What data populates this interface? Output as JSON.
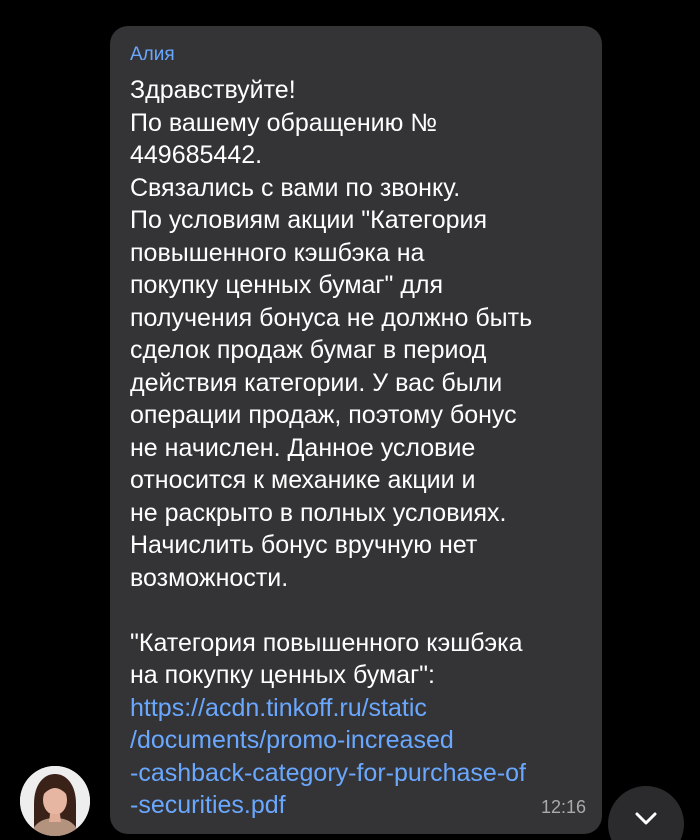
{
  "message": {
    "sender": "Алия",
    "time": "12:16",
    "lines": [
      "Здравствуйте!",
      "По вашему обращению №",
      "449685442.",
      "Связались с вами по звонку.",
      "По условиям акции \"Категория",
      "повышенного кэшбэка на",
      "покупку ценных бумаг\" для",
      "получения бонуса не должно быть",
      "сделок продаж бумаг в период",
      "действия категории. У вас были",
      "операции продаж, поэтому бонус",
      "не начислен. Данное условие",
      "относится к механике акции и",
      "не раскрыто в полных условиях.",
      "Начислить бонус вручную нет",
      "возможности.",
      "",
      "\"Категория повышенного кэшбэка",
      "на покупку ценных бумаг\":"
    ],
    "link_lines": [
      "https://acdn.tinkoff.ru/static",
      "/documents/promo-increased",
      "-cashback-category-for-purchase-of",
      "-securities.pdf"
    ]
  },
  "colors": {
    "background": "#000000",
    "bubble": "#343436",
    "sender": "#6aa8ff",
    "link": "#6aa8ff",
    "time": "#a9a9ae"
  },
  "icons": {
    "scroll_down": "chevron-down-icon",
    "avatar": "user-avatar"
  }
}
